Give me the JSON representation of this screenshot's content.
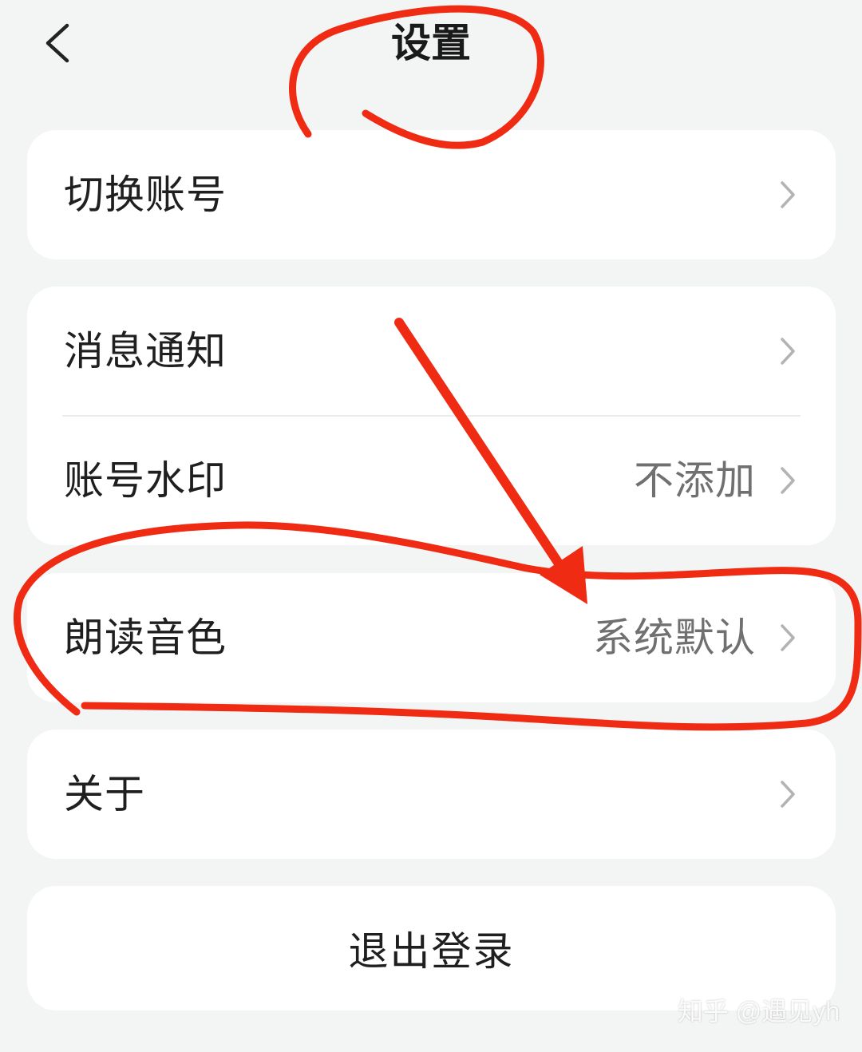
{
  "header": {
    "title": "设置",
    "back_icon": "chevron-left-icon"
  },
  "card_account": {
    "items": [
      {
        "label": "切换账号",
        "value": ""
      }
    ]
  },
  "card_settings": {
    "items": [
      {
        "label": "消息通知",
        "value": ""
      },
      {
        "label": "账号水印",
        "value": "不添加"
      }
    ]
  },
  "card_voice": {
    "items": [
      {
        "label": "朗读音色",
        "value": "系统默认"
      }
    ]
  },
  "card_about": {
    "items": [
      {
        "label": "关于",
        "value": ""
      }
    ]
  },
  "logout": {
    "label": "退出登录"
  },
  "watermark": {
    "text": "知乎 @遇见yh"
  },
  "colors": {
    "background": "#f3f4f4",
    "card": "#ffffff",
    "annotation": "#f02b13",
    "value_text": "#707070",
    "chevron": "#b3b3b3"
  }
}
